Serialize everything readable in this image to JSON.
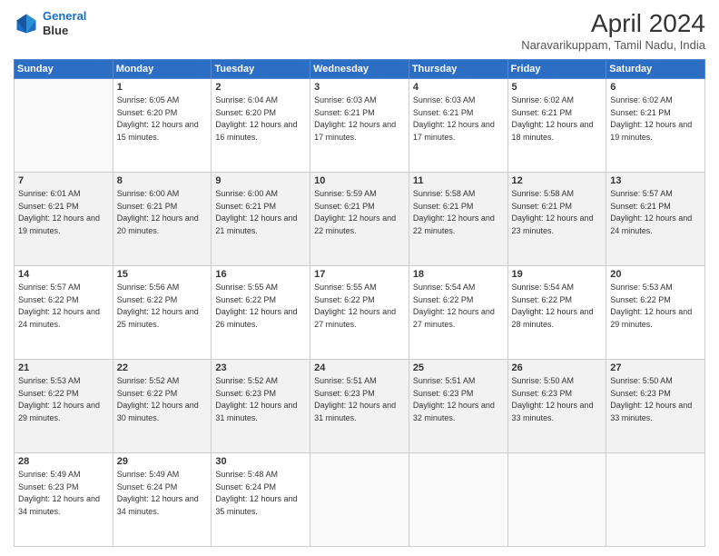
{
  "logo": {
    "line1": "General",
    "line2": "Blue"
  },
  "title": "April 2024",
  "subtitle": "Naravarikuppam, Tamil Nadu, India",
  "weekdays": [
    "Sunday",
    "Monday",
    "Tuesday",
    "Wednesday",
    "Thursday",
    "Friday",
    "Saturday"
  ],
  "weeks": [
    [
      {
        "day": "",
        "sunrise": "",
        "sunset": "",
        "daylight": ""
      },
      {
        "day": "1",
        "sunrise": "Sunrise: 6:05 AM",
        "sunset": "Sunset: 6:20 PM",
        "daylight": "Daylight: 12 hours and 15 minutes."
      },
      {
        "day": "2",
        "sunrise": "Sunrise: 6:04 AM",
        "sunset": "Sunset: 6:20 PM",
        "daylight": "Daylight: 12 hours and 16 minutes."
      },
      {
        "day": "3",
        "sunrise": "Sunrise: 6:03 AM",
        "sunset": "Sunset: 6:21 PM",
        "daylight": "Daylight: 12 hours and 17 minutes."
      },
      {
        "day": "4",
        "sunrise": "Sunrise: 6:03 AM",
        "sunset": "Sunset: 6:21 PM",
        "daylight": "Daylight: 12 hours and 17 minutes."
      },
      {
        "day": "5",
        "sunrise": "Sunrise: 6:02 AM",
        "sunset": "Sunset: 6:21 PM",
        "daylight": "Daylight: 12 hours and 18 minutes."
      },
      {
        "day": "6",
        "sunrise": "Sunrise: 6:02 AM",
        "sunset": "Sunset: 6:21 PM",
        "daylight": "Daylight: 12 hours and 19 minutes."
      }
    ],
    [
      {
        "day": "7",
        "sunrise": "Sunrise: 6:01 AM",
        "sunset": "Sunset: 6:21 PM",
        "daylight": "Daylight: 12 hours and 19 minutes."
      },
      {
        "day": "8",
        "sunrise": "Sunrise: 6:00 AM",
        "sunset": "Sunset: 6:21 PM",
        "daylight": "Daylight: 12 hours and 20 minutes."
      },
      {
        "day": "9",
        "sunrise": "Sunrise: 6:00 AM",
        "sunset": "Sunset: 6:21 PM",
        "daylight": "Daylight: 12 hours and 21 minutes."
      },
      {
        "day": "10",
        "sunrise": "Sunrise: 5:59 AM",
        "sunset": "Sunset: 6:21 PM",
        "daylight": "Daylight: 12 hours and 22 minutes."
      },
      {
        "day": "11",
        "sunrise": "Sunrise: 5:58 AM",
        "sunset": "Sunset: 6:21 PM",
        "daylight": "Daylight: 12 hours and 22 minutes."
      },
      {
        "day": "12",
        "sunrise": "Sunrise: 5:58 AM",
        "sunset": "Sunset: 6:21 PM",
        "daylight": "Daylight: 12 hours and 23 minutes."
      },
      {
        "day": "13",
        "sunrise": "Sunrise: 5:57 AM",
        "sunset": "Sunset: 6:21 PM",
        "daylight": "Daylight: 12 hours and 24 minutes."
      }
    ],
    [
      {
        "day": "14",
        "sunrise": "Sunrise: 5:57 AM",
        "sunset": "Sunset: 6:22 PM",
        "daylight": "Daylight: 12 hours and 24 minutes."
      },
      {
        "day": "15",
        "sunrise": "Sunrise: 5:56 AM",
        "sunset": "Sunset: 6:22 PM",
        "daylight": "Daylight: 12 hours and 25 minutes."
      },
      {
        "day": "16",
        "sunrise": "Sunrise: 5:55 AM",
        "sunset": "Sunset: 6:22 PM",
        "daylight": "Daylight: 12 hours and 26 minutes."
      },
      {
        "day": "17",
        "sunrise": "Sunrise: 5:55 AM",
        "sunset": "Sunset: 6:22 PM",
        "daylight": "Daylight: 12 hours and 27 minutes."
      },
      {
        "day": "18",
        "sunrise": "Sunrise: 5:54 AM",
        "sunset": "Sunset: 6:22 PM",
        "daylight": "Daylight: 12 hours and 27 minutes."
      },
      {
        "day": "19",
        "sunrise": "Sunrise: 5:54 AM",
        "sunset": "Sunset: 6:22 PM",
        "daylight": "Daylight: 12 hours and 28 minutes."
      },
      {
        "day": "20",
        "sunrise": "Sunrise: 5:53 AM",
        "sunset": "Sunset: 6:22 PM",
        "daylight": "Daylight: 12 hours and 29 minutes."
      }
    ],
    [
      {
        "day": "21",
        "sunrise": "Sunrise: 5:53 AM",
        "sunset": "Sunset: 6:22 PM",
        "daylight": "Daylight: 12 hours and 29 minutes."
      },
      {
        "day": "22",
        "sunrise": "Sunrise: 5:52 AM",
        "sunset": "Sunset: 6:22 PM",
        "daylight": "Daylight: 12 hours and 30 minutes."
      },
      {
        "day": "23",
        "sunrise": "Sunrise: 5:52 AM",
        "sunset": "Sunset: 6:23 PM",
        "daylight": "Daylight: 12 hours and 31 minutes."
      },
      {
        "day": "24",
        "sunrise": "Sunrise: 5:51 AM",
        "sunset": "Sunset: 6:23 PM",
        "daylight": "Daylight: 12 hours and 31 minutes."
      },
      {
        "day": "25",
        "sunrise": "Sunrise: 5:51 AM",
        "sunset": "Sunset: 6:23 PM",
        "daylight": "Daylight: 12 hours and 32 minutes."
      },
      {
        "day": "26",
        "sunrise": "Sunrise: 5:50 AM",
        "sunset": "Sunset: 6:23 PM",
        "daylight": "Daylight: 12 hours and 33 minutes."
      },
      {
        "day": "27",
        "sunrise": "Sunrise: 5:50 AM",
        "sunset": "Sunset: 6:23 PM",
        "daylight": "Daylight: 12 hours and 33 minutes."
      }
    ],
    [
      {
        "day": "28",
        "sunrise": "Sunrise: 5:49 AM",
        "sunset": "Sunset: 6:23 PM",
        "daylight": "Daylight: 12 hours and 34 minutes."
      },
      {
        "day": "29",
        "sunrise": "Sunrise: 5:49 AM",
        "sunset": "Sunset: 6:24 PM",
        "daylight": "Daylight: 12 hours and 34 minutes."
      },
      {
        "day": "30",
        "sunrise": "Sunrise: 5:48 AM",
        "sunset": "Sunset: 6:24 PM",
        "daylight": "Daylight: 12 hours and 35 minutes."
      },
      {
        "day": "",
        "sunrise": "",
        "sunset": "",
        "daylight": ""
      },
      {
        "day": "",
        "sunrise": "",
        "sunset": "",
        "daylight": ""
      },
      {
        "day": "",
        "sunrise": "",
        "sunset": "",
        "daylight": ""
      },
      {
        "day": "",
        "sunrise": "",
        "sunset": "",
        "daylight": ""
      }
    ]
  ]
}
